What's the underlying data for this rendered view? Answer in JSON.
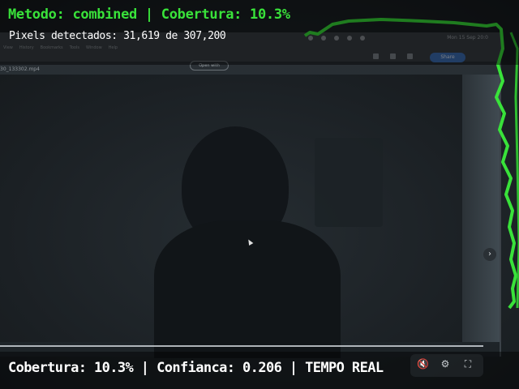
{
  "overlay": {
    "title": "Metodo: combined | Cobertura: 10.3%",
    "pixels": "Pixels detectados: 31,619 de 307,200",
    "status": "Cobertura: 10.3% | Confianca: 0.206 | TEMPO REAL"
  },
  "colors": {
    "detection_green": "#39e23a",
    "overlay_text": "#ffffff"
  },
  "screen": {
    "menu": [
      "View",
      "History",
      "Bookmarks",
      "Tools",
      "Window",
      "Help"
    ],
    "time": "Mon 15 Sep  20:0",
    "share_label": "Share",
    "open_with_label": "Open with",
    "file_name": "30_133302.mp4"
  },
  "player_controls": {
    "mute_icon": "🔇",
    "settings_icon": "⚙",
    "fullscreen_icon": "⛶",
    "next_icon": "›"
  }
}
